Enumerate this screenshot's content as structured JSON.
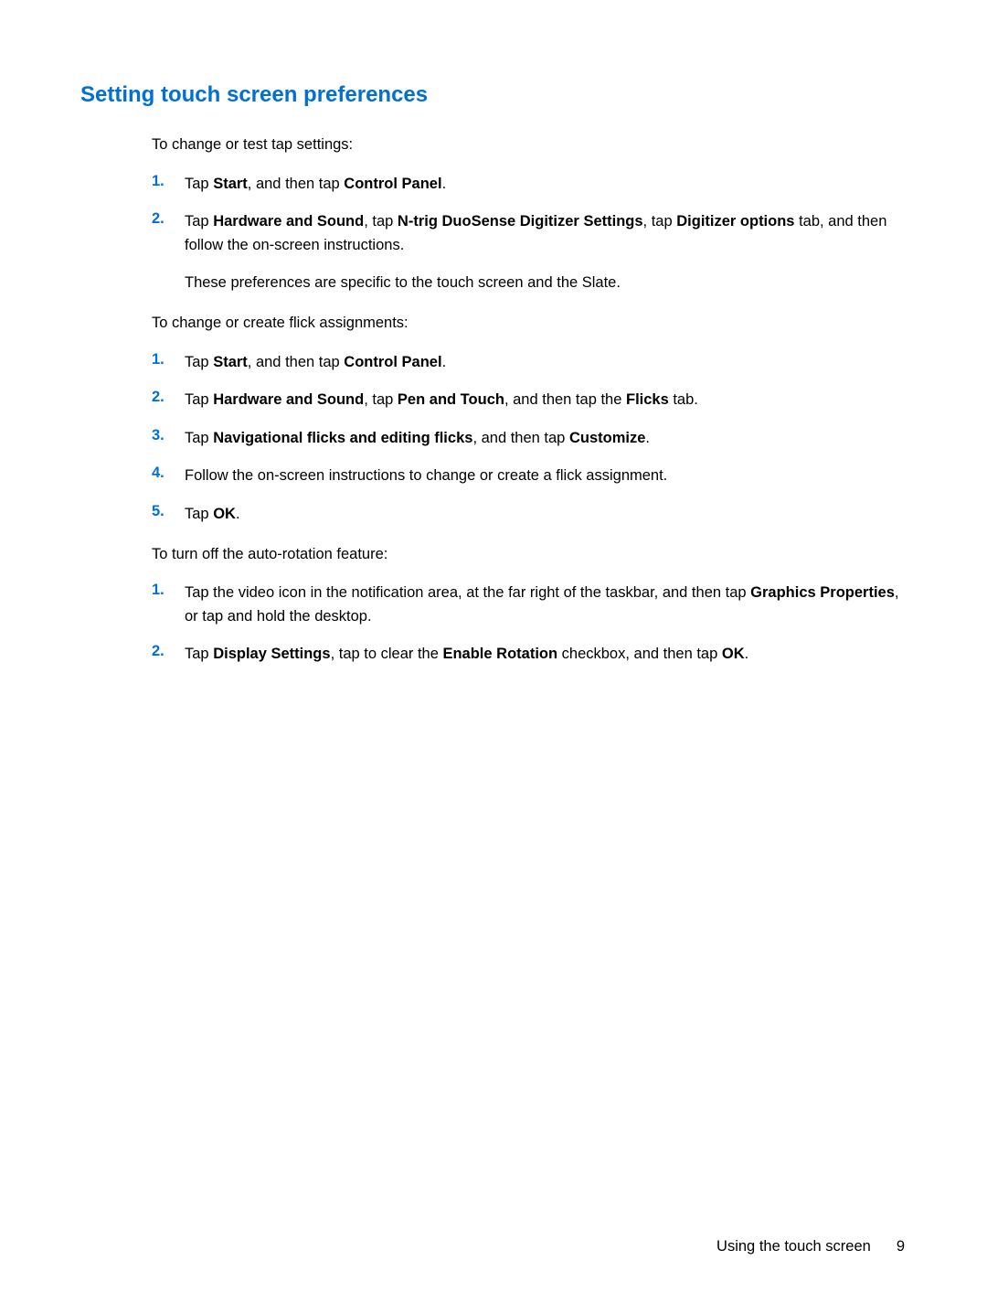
{
  "heading": "Setting touch screen preferences",
  "intro1": "To change or test tap settings:",
  "list1": {
    "item1": {
      "num": "1.",
      "pre": "Tap ",
      "b1": "Start",
      "mid1": ", and then tap ",
      "b2": "Control Panel",
      "post": "."
    },
    "item2": {
      "num": "2.",
      "pre": "Tap ",
      "b1": "Hardware and Sound",
      "mid1": ", tap ",
      "b2": "N-trig DuoSense Digitizer Settings",
      "mid2": ", tap ",
      "b3": "Digitizer options",
      "post": " tab, and then follow the on-screen instructions.",
      "note": "These preferences are specific to the touch screen and the Slate."
    }
  },
  "intro2": "To change or create flick assignments:",
  "list2": {
    "item1": {
      "num": "1.",
      "pre": "Tap ",
      "b1": "Start",
      "mid1": ", and then tap ",
      "b2": "Control Panel",
      "post": "."
    },
    "item2": {
      "num": "2.",
      "pre": "Tap ",
      "b1": "Hardware and Sound",
      "mid1": ", tap ",
      "b2": "Pen and Touch",
      "mid2": ", and then tap the ",
      "b3": "Flicks",
      "post": " tab."
    },
    "item3": {
      "num": "3.",
      "pre": "Tap ",
      "b1": "Navigational flicks and editing flicks",
      "mid1": ", and then tap ",
      "b2": "Customize",
      "post": "."
    },
    "item4": {
      "num": "4.",
      "text": "Follow the on-screen instructions to change or create a flick assignment."
    },
    "item5": {
      "num": "5.",
      "pre": "Tap ",
      "b1": "OK",
      "post": "."
    }
  },
  "intro3": "To turn off the auto-rotation feature:",
  "list3": {
    "item1": {
      "num": "1.",
      "pre": "Tap the video icon in the notification area, at the far right of the taskbar, and then tap ",
      "b1": "Graphics Properties",
      "post": ", or tap and hold the desktop."
    },
    "item2": {
      "num": "2.",
      "pre": "Tap ",
      "b1": "Display Settings",
      "mid1": ", tap to clear the ",
      "b2": "Enable Rotation",
      "mid2": " checkbox, and then tap ",
      "b3": "OK",
      "post": "."
    }
  },
  "footer": {
    "text": "Using the touch screen",
    "page": "9"
  }
}
